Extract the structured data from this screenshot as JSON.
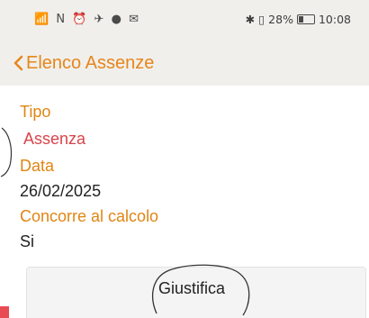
{
  "status_bar": {
    "left_icons": "📶 N ⏰ ✈ ● ✉",
    "battery_text": "28%",
    "time": "10:08",
    "battery_level": 0.28
  },
  "nav": {
    "back_label": "Elenco Assenze",
    "accent_color": "#e7861a"
  },
  "fields": [
    {
      "label": "Tipo",
      "value": "Assenza"
    },
    {
      "label": "Data",
      "value": "26/02/2025"
    },
    {
      "label": "Concorre al calcolo",
      "value": "Si"
    }
  ],
  "actions": {
    "justify_label": "Giustifica"
  }
}
